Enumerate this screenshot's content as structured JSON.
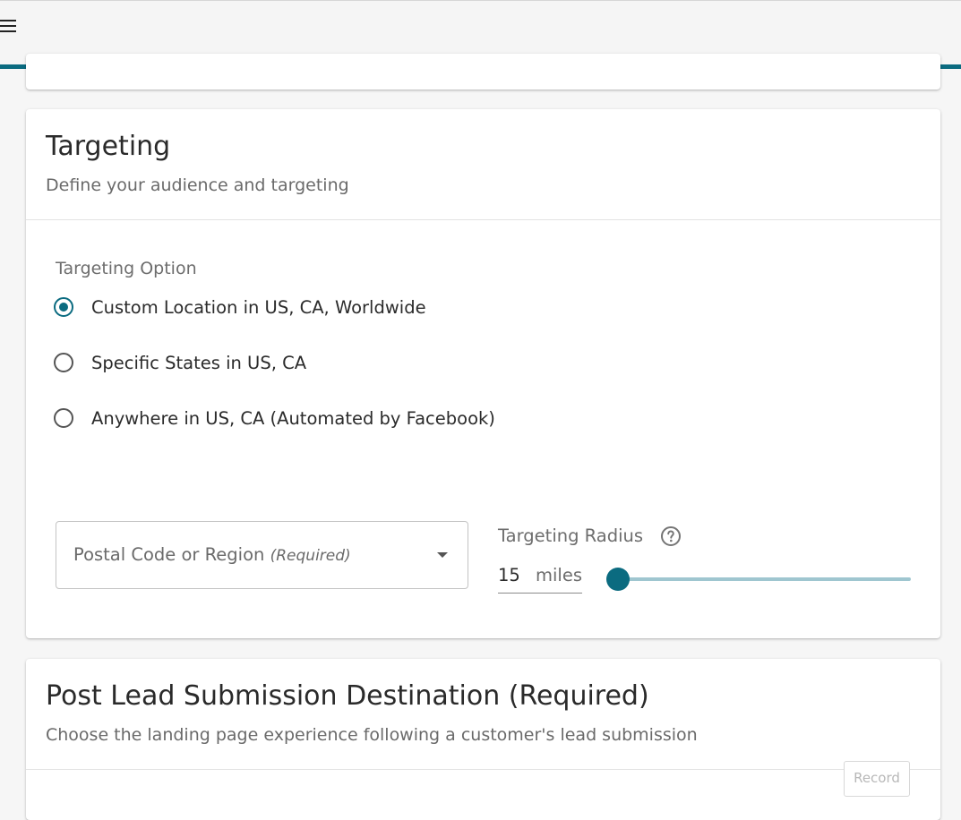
{
  "colors": {
    "accent": "#0b6b80",
    "accent_light": "#9fc6d0",
    "topbar_bg": "#f5f5f5",
    "page_bg": "#f6f6f6"
  },
  "header": {
    "menu_icon": "hamburger-menu-icon"
  },
  "targeting": {
    "title": "Targeting",
    "subtitle": "Define your audience and targeting",
    "option_label": "Targeting Option",
    "options": [
      {
        "label": "Custom Location in US, CA, Worldwide",
        "selected": true
      },
      {
        "label": "Specific States in US, CA",
        "selected": false
      },
      {
        "label": "Anywhere in US, CA (Automated by Facebook)",
        "selected": false
      }
    ],
    "postal": {
      "placeholder": "Postal Code or Region",
      "required_hint": "(Required)"
    },
    "radius": {
      "label": "Targeting Radius",
      "value": "15",
      "unit": "miles",
      "help_icon": "question-circle-icon"
    }
  },
  "post_lead": {
    "title": "Post Lead Submission Destination (Required)",
    "subtitle": "Choose the landing page experience following a customer's lead submission",
    "record_button": "Record"
  }
}
